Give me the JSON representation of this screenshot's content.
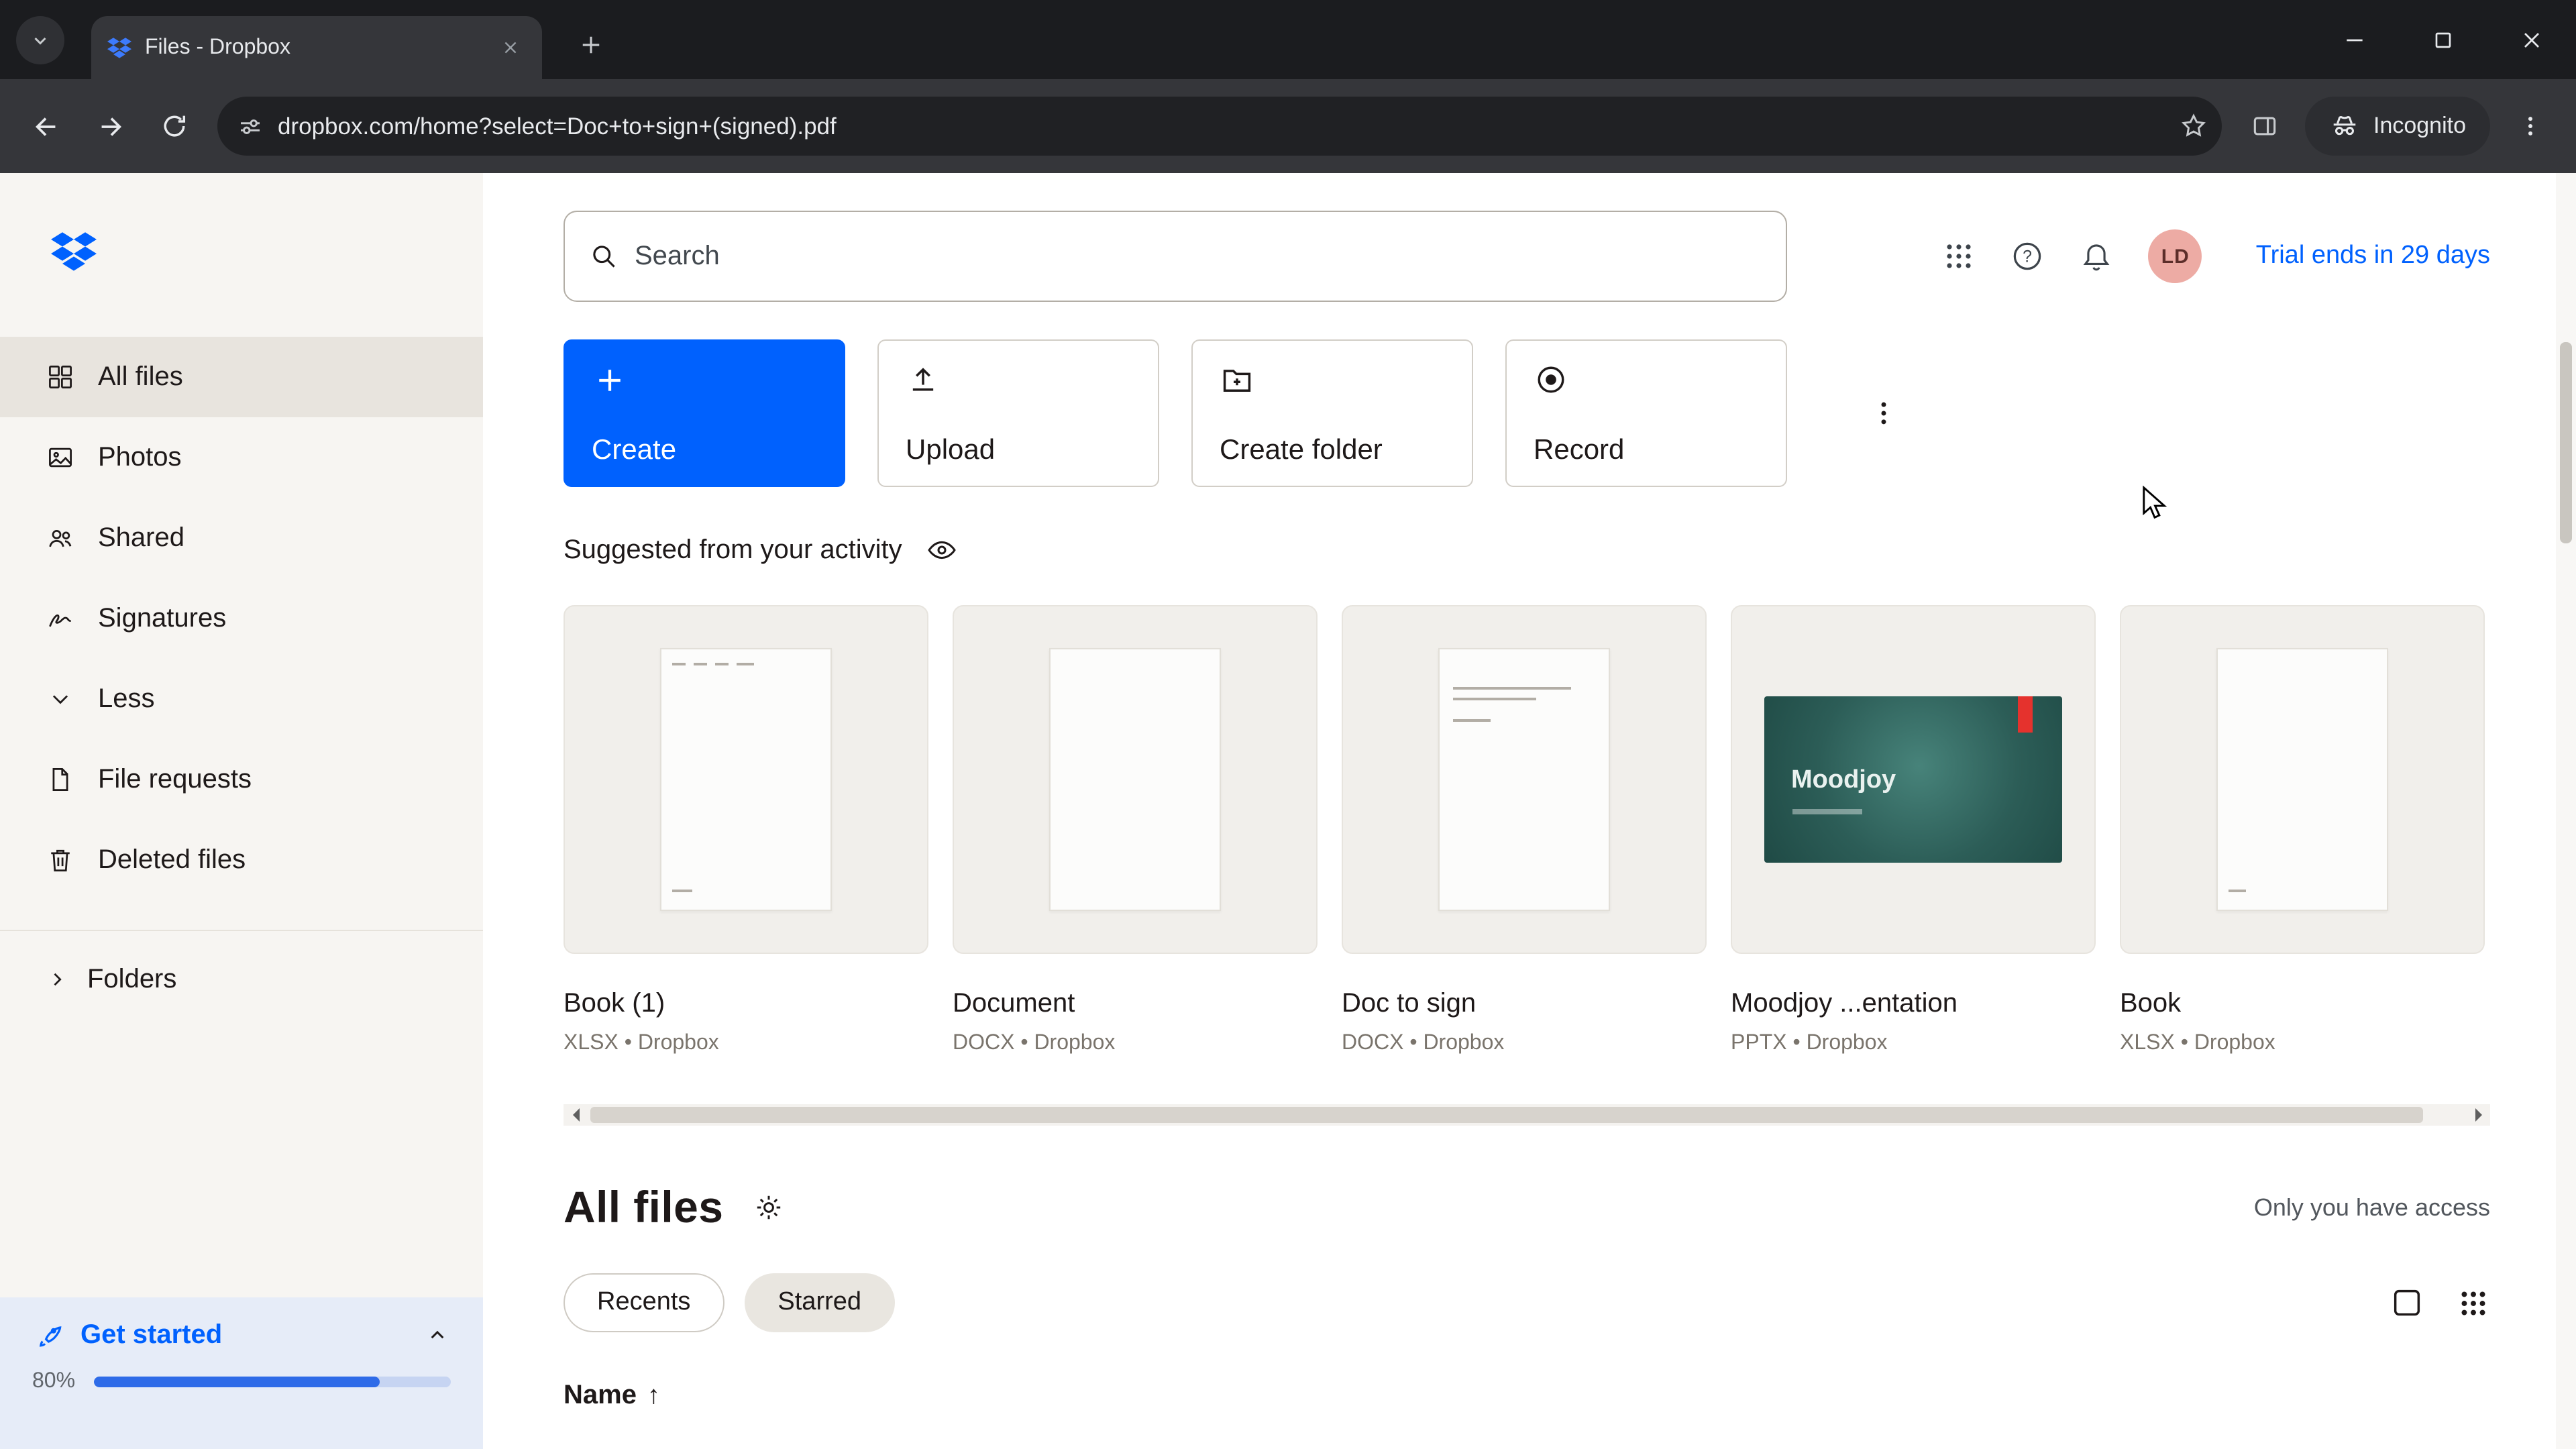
{
  "browser": {
    "tab_title": "Files - Dropbox",
    "url": "dropbox.com/home?select=Doc+to+sign+(signed).pdf",
    "incognito_label": "Incognito"
  },
  "topbar": {
    "search_placeholder": "Search",
    "avatar_initials": "LD",
    "trial_label": "Trial ends in 29 days"
  },
  "sidebar": {
    "items": [
      {
        "label": "All files"
      },
      {
        "label": "Photos"
      },
      {
        "label": "Shared"
      },
      {
        "label": "Signatures"
      },
      {
        "label": "Less"
      },
      {
        "label": "File requests"
      },
      {
        "label": "Deleted files"
      }
    ],
    "folders_label": "Folders",
    "get_started": {
      "label": "Get started",
      "percent_label": "80%",
      "bar_style": "width:80%"
    }
  },
  "actions": {
    "create_label": "Create",
    "upload_label": "Upload",
    "create_folder_label": "Create folder",
    "record_label": "Record"
  },
  "suggested": {
    "title": "Suggested from your activity",
    "cards": [
      {
        "name": "Book (1)",
        "meta": "XLSX • Dropbox"
      },
      {
        "name": "Document",
        "meta": "DOCX • Dropbox"
      },
      {
        "name": "Doc to sign",
        "meta": "DOCX • Dropbox"
      },
      {
        "name": "Moodjoy ...entation",
        "meta": "PPTX • Dropbox",
        "thumb_title": "Moodjoy"
      },
      {
        "name": "Book",
        "meta": "XLSX • Dropbox"
      }
    ]
  },
  "files": {
    "title": "All files",
    "access_label": "Only you have access",
    "chips": [
      {
        "label": "Recents"
      },
      {
        "label": "Starred"
      }
    ],
    "name_column": "Name",
    "sort_indicator": "↑"
  },
  "colors": {
    "accent_blue": "#0061fe",
    "sidebar_bg": "#f7f5f2",
    "selected_item_bg": "#e8e4de",
    "avatar_bg": "#edaba4",
    "presentation_teal": "#2c5d57",
    "presentation_tag_red": "#e5322d",
    "progress_fill": "#2e6be8",
    "get_started_bg": "#e6ecf8"
  }
}
